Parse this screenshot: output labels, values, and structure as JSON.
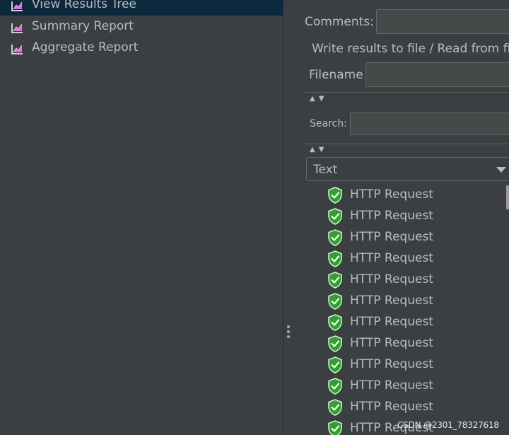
{
  "tree": {
    "items": [
      {
        "label": "View Results Tree",
        "selected": true,
        "icon": "chart-listener-icon"
      },
      {
        "label": "Summary Report",
        "selected": false,
        "icon": "chart-listener-icon"
      },
      {
        "label": "Aggregate Report",
        "selected": false,
        "icon": "chart-listener-icon"
      }
    ]
  },
  "form": {
    "comments_label": "Comments:",
    "comments_value": "",
    "file_group_title": "Write results to file / Read from file",
    "filename_label": "Filename",
    "filename_value": "",
    "search_label": "Search:",
    "search_value": ""
  },
  "renderer": {
    "selected": "Text"
  },
  "results": [
    {
      "label": "HTTP Request",
      "status": "success"
    },
    {
      "label": "HTTP Request",
      "status": "success"
    },
    {
      "label": "HTTP Request",
      "status": "success"
    },
    {
      "label": "HTTP Request",
      "status": "success"
    },
    {
      "label": "HTTP Request",
      "status": "success"
    },
    {
      "label": "HTTP Request",
      "status": "success"
    },
    {
      "label": "HTTP Request",
      "status": "success"
    },
    {
      "label": "HTTP Request",
      "status": "success"
    },
    {
      "label": "HTTP Request",
      "status": "success"
    },
    {
      "label": "HTTP Request",
      "status": "success"
    },
    {
      "label": "HTTP Request",
      "status": "success"
    },
    {
      "label": "HTTP Request",
      "status": "success"
    }
  ],
  "watermark": "CSDN @2301_78327618",
  "colors": {
    "background": "#3c3f41",
    "selection": "#0d293e",
    "text": "#bbbbbb",
    "success_green": "#2fa12f",
    "field_bg": "#45494a"
  }
}
